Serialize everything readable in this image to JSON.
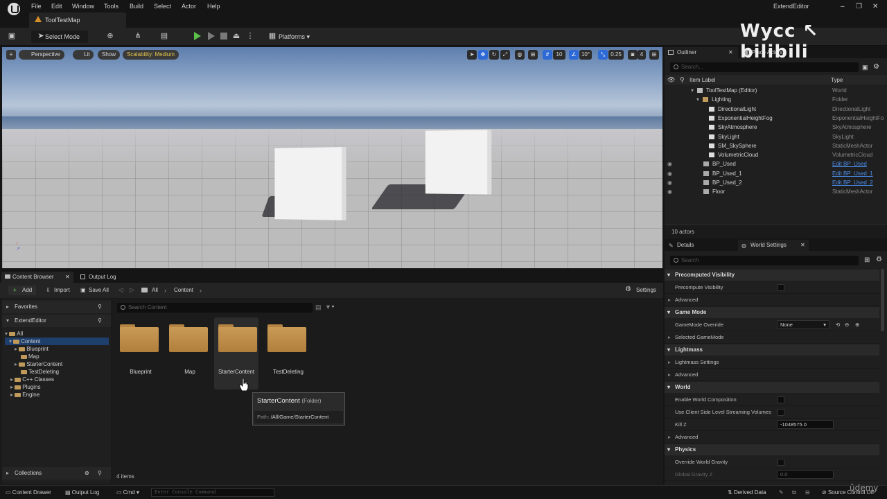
{
  "menubar": {
    "items": [
      "File",
      "Edit",
      "Window",
      "Tools",
      "Build",
      "Select",
      "Actor",
      "Help"
    ],
    "project_title": "ExtendEditor",
    "map_tab": "ToolTestMap"
  },
  "toolbar": {
    "select_mode": "Select Mode",
    "platforms": "Platforms"
  },
  "viewport": {
    "perspective": "Perspective",
    "lit": "Lit",
    "show": "Show",
    "scalability": "Scalability: Medium",
    "grid_snap": "10",
    "rot_snap": "10°",
    "scale_snap": "0.25",
    "camera_speed": "4"
  },
  "outliner": {
    "tab": "Outliner",
    "place_actors_tab": "Place Actors",
    "search_placeholder": "Search...",
    "col_label": "Item Label",
    "col_type": "Type",
    "rows": [
      {
        "label": "ToolTestMap (Editor)",
        "type": "World",
        "link": false
      },
      {
        "label": "Lighting",
        "type": "Folder",
        "link": false
      },
      {
        "label": "DirectionalLight",
        "type": "DirectionalLight",
        "link": false
      },
      {
        "label": "ExponentialHeightFog",
        "type": "ExponentialHeightFo",
        "link": false
      },
      {
        "label": "SkyAtmosphere",
        "type": "SkyAtmosphere",
        "link": false
      },
      {
        "label": "SkyLight",
        "type": "SkyLight",
        "link": false
      },
      {
        "label": "SM_SkySphere",
        "type": "StaticMeshActor",
        "link": false
      },
      {
        "label": "VolumetricCloud",
        "type": "VolumetricCloud",
        "link": false
      },
      {
        "label": "BP_Used",
        "type": "Edit BP_Used",
        "link": true
      },
      {
        "label": "BP_Used_1",
        "type": "Edit BP_Used_1",
        "link": true
      },
      {
        "label": "BP_Used_2",
        "type": "Edit BP_Used_2",
        "link": true
      },
      {
        "label": "Floor",
        "type": "StaticMeshActor",
        "link": false
      }
    ],
    "actor_count": "10 actors"
  },
  "details": {
    "tab": "Details",
    "world_settings_tab": "World Settings",
    "search_placeholder": "Search",
    "categories": {
      "precomputed_visibility": "Precomputed Visibility",
      "precompute_visibility": "Precompute Visibility",
      "advanced": "Advanced",
      "game_mode": "Game Mode",
      "gamemode_override": "GameMode Override",
      "gamemode_value": "None",
      "selected_gamemode": "Selected GameMode",
      "lightmass": "Lightmass",
      "lightmass_settings": "Lightmass Settings",
      "world": "World",
      "enable_world_composition": "Enable World Composition",
      "use_client_side": "Use Client Side Level Streaming Volumes",
      "kill_z": "Kill Z",
      "kill_z_value": "-1048575.0",
      "physics": "Physics",
      "override_world_gravity": "Override World Gravity",
      "global_gravity_z": "Global Gravity Z",
      "global_gravity_value": "0.0"
    }
  },
  "content_browser": {
    "tab": "Content Browser",
    "output_log_tab": "Output Log",
    "add": "Add",
    "import": "Import",
    "save_all": "Save All",
    "path_all": "All",
    "path_content": "Content",
    "settings": "Settings",
    "favorites": "Favorites",
    "project": "ExtendEditor",
    "tree": [
      "All",
      "Content",
      "Blueprint",
      "Map",
      "StarterContent",
      "TestDeleting",
      "C++ Classes",
      "Plugins",
      "Engine"
    ],
    "search_placeholder": "Search Content",
    "folders": [
      "Blueprint",
      "Map",
      "StarterContent",
      "TestDeleting"
    ],
    "collections": "Collections",
    "item_count": "4 items",
    "tooltip": {
      "name": "StarterContent",
      "kind": "(Folder)",
      "path_label": "Path:",
      "path": "/All/Game/StarterContent"
    }
  },
  "statusbar": {
    "content_drawer": "Content Drawer",
    "output_log": "Output Log",
    "cmd": "Cmd",
    "console_placeholder": "Enter Console Command",
    "derived_data": "Derived Data",
    "source_control": "Source Control Off"
  },
  "watermark": {
    "text": "Wycc ↖ bilibili",
    "udemy": "ûdemy"
  }
}
